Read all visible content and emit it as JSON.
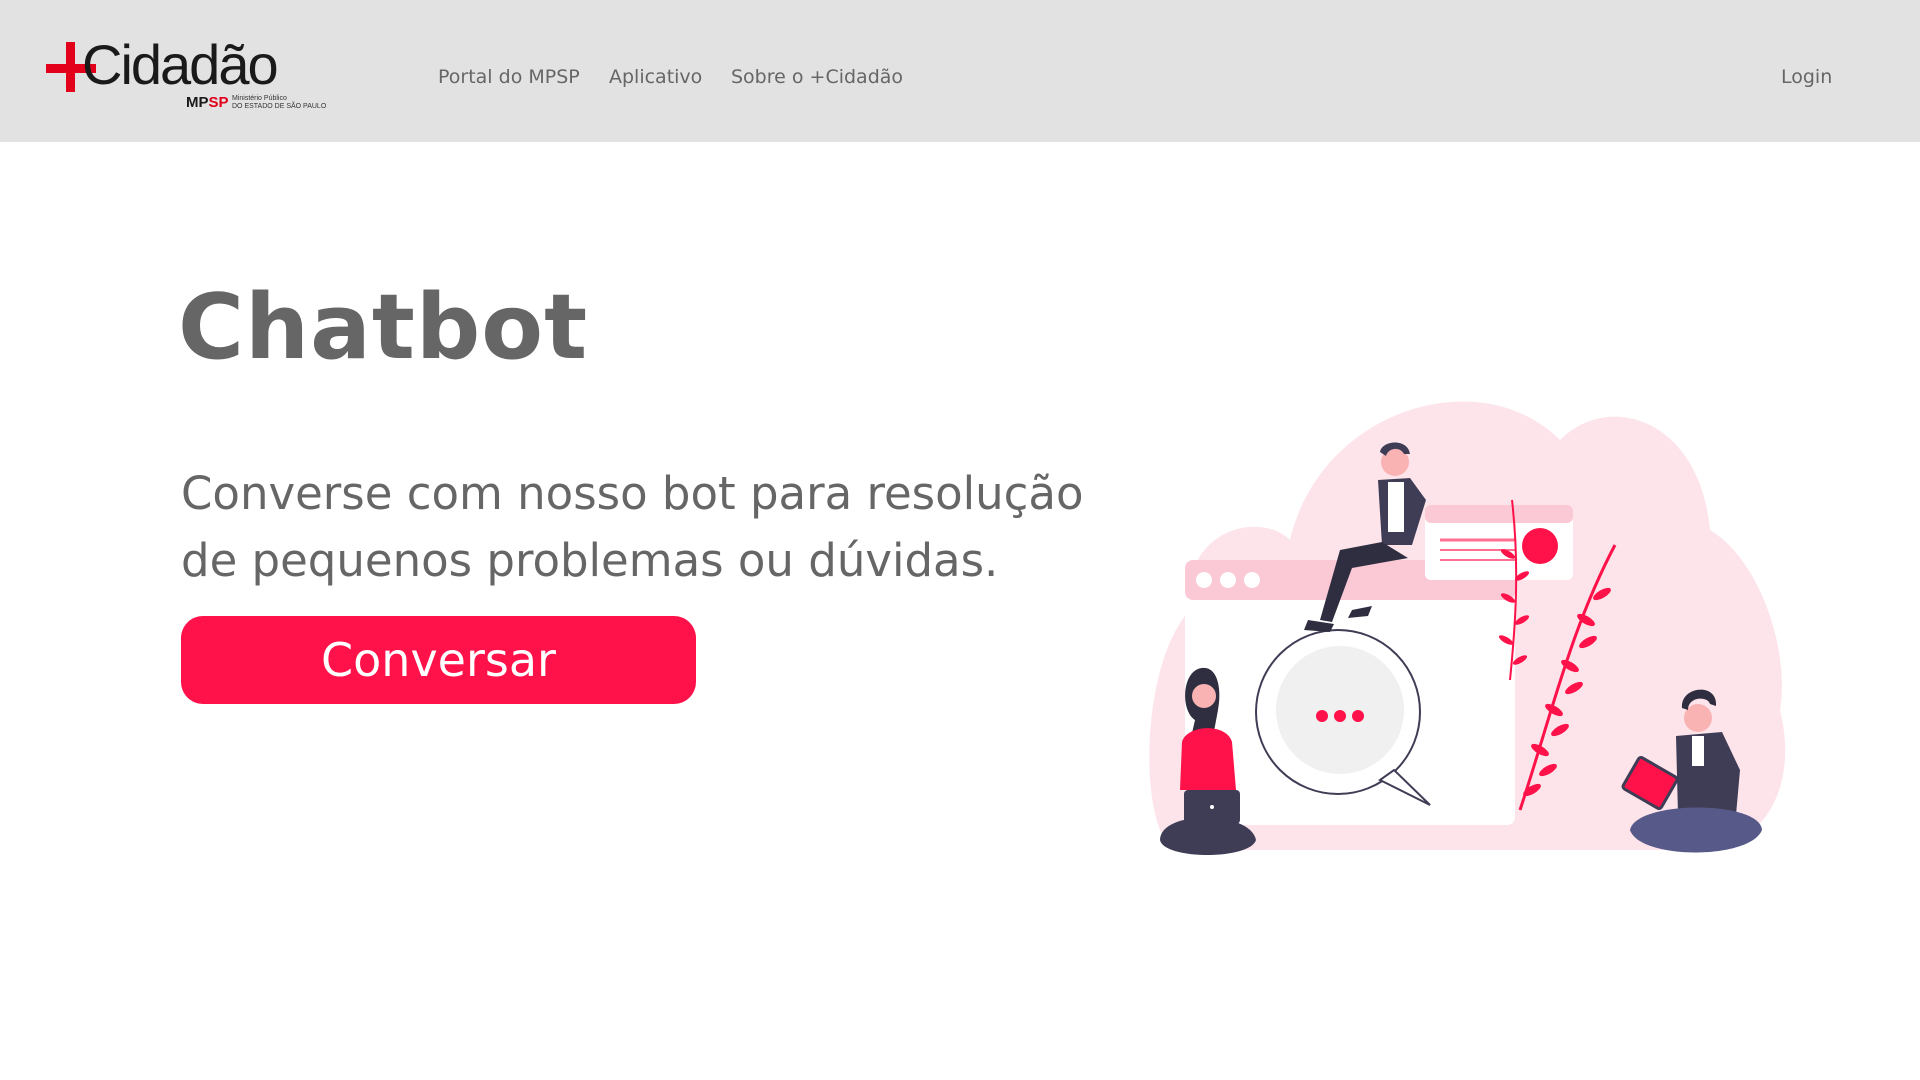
{
  "header": {
    "logo": {
      "brand": "Cidadão",
      "mp": "MP",
      "sp": "SP",
      "sub_line1": "Ministério Público",
      "sub_line2": "DO ESTADO DE SÃO PAULO"
    },
    "nav": [
      {
        "label": "Portal do MPSP"
      },
      {
        "label": "Aplicativo"
      },
      {
        "label": "Sobre o +Cidadão"
      }
    ],
    "login_label": "Login"
  },
  "main": {
    "title": "Chatbot",
    "description": "Converse com nosso bot para resolução de pequenos problemas ou dúvidas.",
    "button_label": "Conversar"
  },
  "colors": {
    "accent": "#ff1149",
    "header_bg": "#e2e2e2",
    "text": "#666666",
    "illustration_pink": "#fde4ea"
  }
}
